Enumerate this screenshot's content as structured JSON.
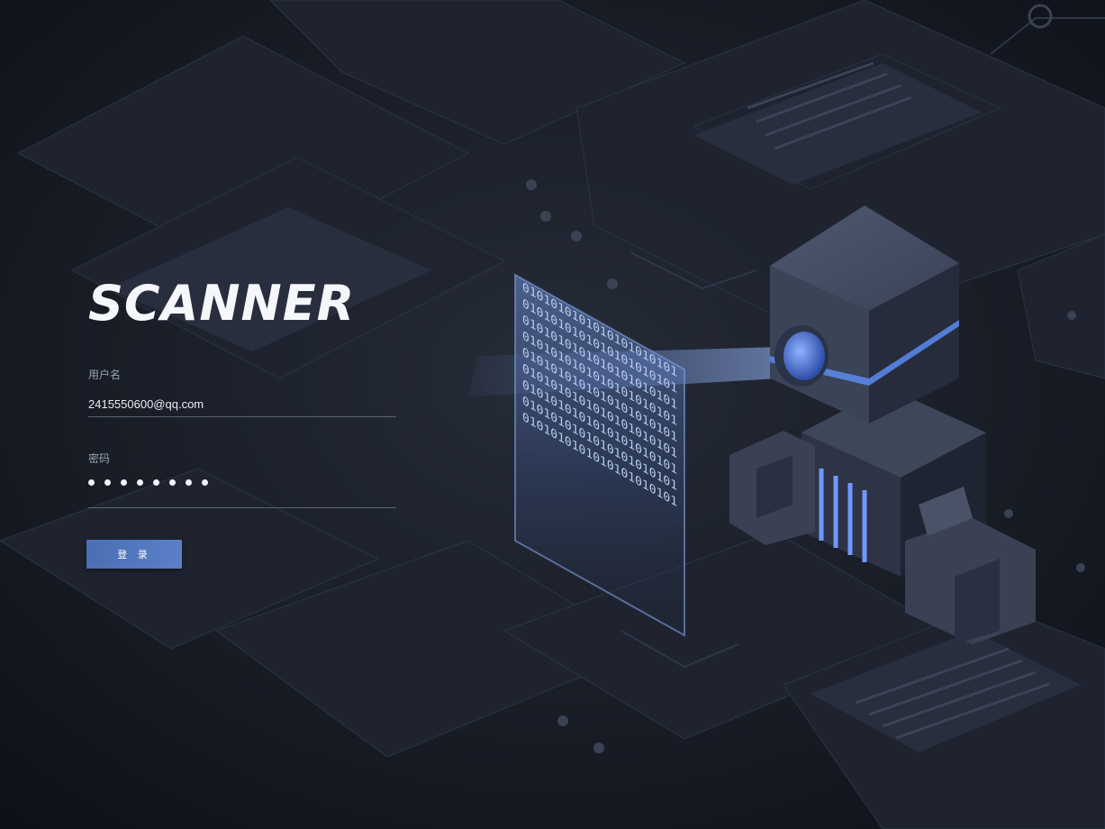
{
  "brand": {
    "logo_text": "SCANNER"
  },
  "login_form": {
    "username_label": "用户名",
    "username_value": "2415550600@qq.com",
    "password_label": "密码",
    "password_dot_count": 8,
    "login_button_label": "登 录"
  },
  "illustration": {
    "binary_text": "0101010101010101010101",
    "accent_color": "#5b8cf0",
    "background_color": "#12161f"
  }
}
